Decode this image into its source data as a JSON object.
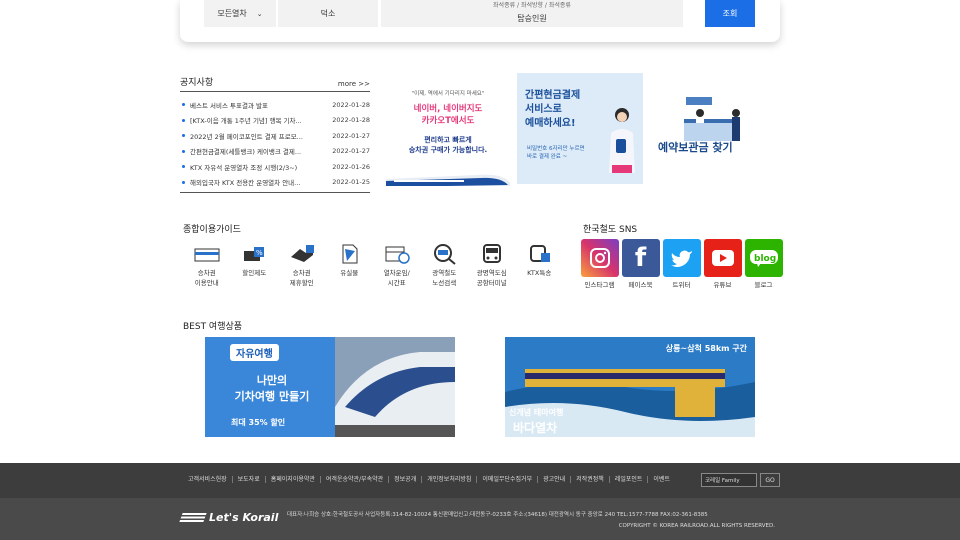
{
  "search": {
    "train_type": "모든열차",
    "station": "덕소",
    "seat_options": "좌석종류 / 좌석방향 / 좌석종류",
    "passengers": "탑승인원",
    "search_button": "조회"
  },
  "notice": {
    "title": "공지사항",
    "more": "more >>",
    "items": [
      {
        "title": "베스트 서비스 투표결과 발표",
        "date": "2022-01-28"
      },
      {
        "title": "[KTX-이음 개통 1주년 기념] 행복 기차...",
        "date": "2022-01-28"
      },
      {
        "title": "2022년 2월 페이코포인트 결제 프로모...",
        "date": "2022-01-27"
      },
      {
        "title": "간편현금결제(세틀뱅크) 케이뱅크 결제...",
        "date": "2022-01-27"
      },
      {
        "title": "KTX 자유석 운영열차 조정 시행(2/3~)",
        "date": "2022-01-26"
      },
      {
        "title": "해외입국자 KTX 전용칸 운영열차 안내...",
        "date": "2022-01-25"
      }
    ]
  },
  "banners": {
    "b1_small": "\"이제, 역에서 기다리지 마세요\"",
    "b1_pink1": "네이버, 네이버지도",
    "b1_pink2": "카카오T에서도",
    "b1_blue1": "편리하고 빠르게",
    "b1_blue2": "승차권 구매가 가능합니다.",
    "b2_l1": "간편현금결제",
    "b2_l2": "서비스로",
    "b2_l3": "예매하세요!",
    "b2_s1": "비밀번호 6자리만 누르면",
    "b2_s2": "바로 결제 완료 ~",
    "b3_text": "예약보관금 찾기"
  },
  "guide": {
    "title": "종합이용가이드",
    "items": [
      {
        "label": "승차권\n이용안내",
        "icon": "ticket-icon"
      },
      {
        "label": "할인제도",
        "icon": "discount-icon"
      },
      {
        "label": "승차권\n제휴할인",
        "icon": "handshake-icon"
      },
      {
        "label": "유실물",
        "icon": "lost-item-icon"
      },
      {
        "label": "열차운임/\n시간표",
        "icon": "timetable-icon"
      },
      {
        "label": "광역철도\n노선검색",
        "icon": "route-search-icon"
      },
      {
        "label": "광명역도심\n공항터미널",
        "icon": "bus-icon"
      },
      {
        "label": "KTX특송",
        "icon": "delivery-icon"
      }
    ]
  },
  "sns": {
    "title": "한국철도 SNS",
    "items": [
      {
        "label": "인스타그램",
        "icon": "instagram-icon",
        "color": "#d6336c"
      },
      {
        "label": "페이스북",
        "icon": "facebook-icon",
        "color": "#3b5998"
      },
      {
        "label": "트위터",
        "icon": "twitter-icon",
        "color": "#1da1f2"
      },
      {
        "label": "유튜브",
        "icon": "youtube-icon",
        "color": "#e62117"
      },
      {
        "label": "블로그",
        "icon": "blog-icon",
        "color": "#2db400"
      }
    ]
  },
  "best": {
    "title": "BEST 여행상품",
    "t1_tag": "자유여행",
    "t1_l1": "나만의",
    "t1_l2": "기차여행 만들기",
    "t1_l3": "최대 35% 할인",
    "t2_route": "상룡~삼척 58km 구간",
    "t2_l1": "신개념 테마여행",
    "t2_l2": "바다열차"
  },
  "footer": {
    "links": [
      "고객서비스헌장",
      "보도자료",
      "홈페이지이용약관",
      "여객운송약관/부속약관",
      "정보공개",
      "개인정보처리방침",
      "이메일무단수집거부",
      "광고안내",
      "저작권정책",
      "레일포인트",
      "이벤트"
    ],
    "family_select": "코레일 Family",
    "go": "GO",
    "logo": "Let's Korail",
    "info": "대표자:나희승   상호:한국철도공사   사업자등록:314-82-10024   통신판매업신고:대전동구-0233호   주소:(34618) 대전광역시 동구 중앙로 240   TEL:1577-7788   FAX:02-361-8385",
    "copyright": "COPYRIGHT © KOREA RAILROAD.ALL RIGHTS RESERVED."
  }
}
